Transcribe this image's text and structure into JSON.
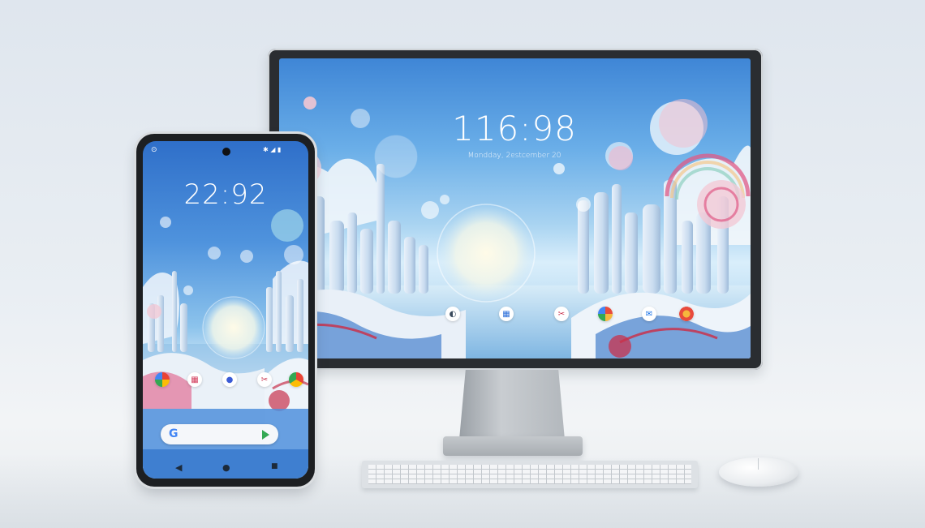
{
  "monitor": {
    "clock": "116:98",
    "date": "Mondday, 2estcember 20",
    "dock_icons": [
      "search-icon",
      "grid-icon",
      "tools-icon",
      "photos-icon",
      "chat-icon",
      "colors-icon"
    ]
  },
  "phone": {
    "clock": "22:92",
    "status_left": "⊙",
    "status_right": "✱ ◢ ▮",
    "dock_icons": [
      "home-icon",
      "grid-icon",
      "contacts-icon",
      "tools-icon",
      "chrome-icon"
    ],
    "search_logo": "G",
    "nav": {
      "back": "◀",
      "home": "●",
      "recents": "■"
    }
  },
  "colors": {
    "sky_top": "#3f86d6",
    "sky_low": "#d9eefb",
    "accent_pink": "#e05a86",
    "accent_red": "#c8324c",
    "frame": "#2a2d31"
  }
}
